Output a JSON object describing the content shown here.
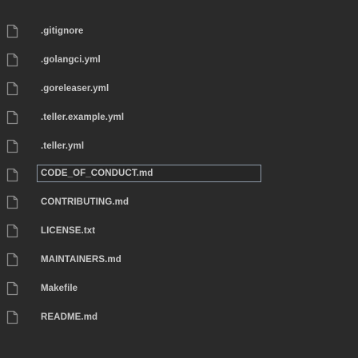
{
  "files": [
    {
      "name": ".gitignore",
      "icon": "file-icon"
    },
    {
      "name": ".golangci.yml",
      "icon": "file-icon"
    },
    {
      "name": ".goreleaser.yml",
      "icon": "file-icon"
    },
    {
      "name": ".teller.example.yml",
      "icon": "file-icon"
    },
    {
      "name": ".teller.yml",
      "icon": "file-icon"
    },
    {
      "name": "CODE_OF_CONDUCT.md",
      "icon": "file-icon",
      "renaming": true
    },
    {
      "name": "CONTRIBUTING.md",
      "icon": "file-icon"
    },
    {
      "name": "LICENSE.txt",
      "icon": "file-icon"
    },
    {
      "name": "MAINTAINERS.md",
      "icon": "file-icon"
    },
    {
      "name": "Makefile",
      "icon": "file-icon"
    },
    {
      "name": "README.md",
      "icon": "file-icon"
    }
  ],
  "colors": {
    "background": "#2a2a2a",
    "text": "#c9c9c9",
    "icon": "#8c8c8c",
    "rename_border": "#8e9aa8"
  }
}
